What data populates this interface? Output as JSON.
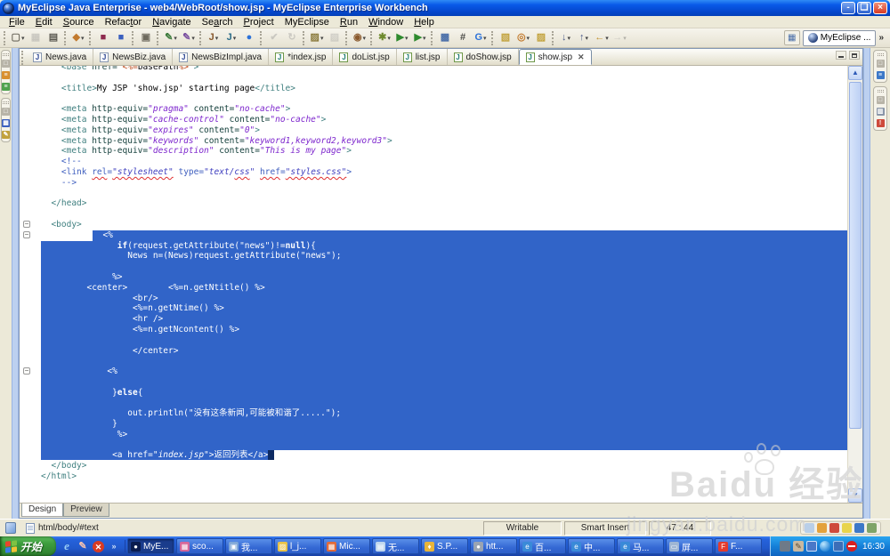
{
  "window": {
    "title": "MyEclipse Java Enterprise - web4/WebRoot/show.jsp - MyEclipse Enterprise Workbench",
    "controls": {
      "minimize": "-",
      "restore": "❏",
      "close": "×"
    }
  },
  "menubar": [
    {
      "label": "File",
      "u": 0
    },
    {
      "label": "Edit",
      "u": 0
    },
    {
      "label": "Source",
      "u": 0
    },
    {
      "label": "Refactor",
      "u": 5
    },
    {
      "label": "Navigate",
      "u": 0
    },
    {
      "label": "Search",
      "u": 2
    },
    {
      "label": "Project",
      "u": 0
    },
    {
      "label": "MyEclipse",
      "u": -1
    },
    {
      "label": "Run",
      "u": 0
    },
    {
      "label": "Window",
      "u": 0
    },
    {
      "label": "Help",
      "u": 0
    }
  ],
  "toolbar": {
    "groups": [
      [
        {
          "n": "new-button",
          "g": "▢",
          "c": "#6E6A5E",
          "dd": 1
        },
        {
          "n": "save-button",
          "g": "▦",
          "c": "#8A877E",
          "dis": 1
        },
        {
          "n": "print-button",
          "g": "▤",
          "c": "#5A5850"
        }
      ],
      [
        {
          "n": "new-web-component-button",
          "g": "◆",
          "c": "#C27A2E",
          "dd": 1
        }
      ],
      [
        {
          "n": "deploy-module-button",
          "g": "■",
          "c": "#8E2A4E"
        },
        {
          "n": "project-deploy-button",
          "g": "■",
          "c": "#3A5FBF"
        }
      ],
      [
        {
          "n": "database-explorer-button",
          "g": "▣",
          "c": "#6E6A5E"
        }
      ],
      [
        {
          "n": "new-class-button",
          "g": "✎",
          "c": "#3C7A3C",
          "dd": 1
        },
        {
          "n": "new-package-button",
          "g": "✎",
          "c": "#7A4FA0",
          "dd": 1
        }
      ],
      [
        {
          "n": "jar-button",
          "g": "J",
          "c": "#8A5A2E",
          "dd": 1
        },
        {
          "n": "jsp-deploy-button",
          "g": "J",
          "c": "#2E6E8A",
          "dd": 1
        },
        {
          "n": "web-browser-button",
          "g": "●",
          "c": "#2C72D9"
        }
      ],
      [
        {
          "n": "validate-button",
          "g": "✔",
          "c": "#8A877E",
          "dis": 1
        },
        {
          "n": "refresh-button",
          "g": "↻",
          "c": "#8A877E",
          "dis": 1
        }
      ],
      [
        {
          "n": "image-capture-button",
          "g": "▨",
          "c": "#8A7A3C",
          "dd": 1
        },
        {
          "n": "mail-button",
          "g": "▨",
          "c": "#9A968C",
          "dis": 1
        }
      ],
      [
        {
          "n": "snapshot-button",
          "g": "◉",
          "c": "#8A5A2E",
          "dd": 1
        }
      ],
      [
        {
          "n": "debug-button",
          "g": "✱",
          "c": "#6E8A2E",
          "dd": 1
        },
        {
          "n": "run-button",
          "g": "▶",
          "c": "#2E8A2E",
          "dd": 1
        },
        {
          "n": "external-tools-button",
          "g": "▶",
          "c": "#2E8A2E",
          "dd": 1
        }
      ],
      [
        {
          "n": "new-ear-button",
          "g": "▩",
          "c": "#4A6EA8"
        },
        {
          "n": "grid-button",
          "g": "#",
          "c": "#4A4A46"
        },
        {
          "n": "browser-g-button",
          "g": "G",
          "c": "#2C72D9",
          "dd": 1
        }
      ],
      [
        {
          "n": "import-button",
          "g": "▧",
          "c": "#C2A23C"
        },
        {
          "n": "search-button",
          "g": "◎",
          "c": "#C27A2E",
          "dd": 1
        },
        {
          "n": "open-folder-button",
          "g": "▨",
          "c": "#C2A23C"
        }
      ],
      [
        {
          "n": "last-edit-location-button",
          "g": "↓",
          "c": "#4A5A8A",
          "dd": 1
        },
        {
          "n": "next-annotation-button",
          "g": "↑",
          "c": "#4A5A8A",
          "dd": 1
        },
        {
          "n": "back-button",
          "g": "←",
          "c": "#C2912E",
          "dd": 1
        },
        {
          "n": "forward-button",
          "g": "→",
          "c": "#9A968C",
          "dis": 1,
          "dd": 1
        }
      ]
    ],
    "perspective": {
      "open_glyph": "▦",
      "label": "MyEclipse ...",
      "more": "»"
    }
  },
  "tabs": [
    {
      "label": "News.java",
      "type": "java"
    },
    {
      "label": "NewsBiz.java",
      "type": "java"
    },
    {
      "label": "NewsBizImpl.java",
      "type": "java"
    },
    {
      "label": "*index.jsp",
      "type": "jsp"
    },
    {
      "label": "doList.jsp",
      "type": "jsp"
    },
    {
      "label": "list.jsp",
      "type": "jsp"
    },
    {
      "label": "doShow.jsp",
      "type": "jsp"
    },
    {
      "label": "show.jsp",
      "type": "jsp",
      "active": true,
      "close": "✕"
    }
  ],
  "editor": {
    "lines": [
      {
        "seg": [
          [
            "t",
            "    <base"
          ],
          [
            "a",
            " href="
          ],
          [
            "v",
            "\""
          ],
          [
            "o",
            "<%="
          ],
          [
            "p",
            "basePath"
          ],
          [
            "o",
            "%>"
          ],
          [
            "v",
            "\""
          ],
          [
            "t",
            ">"
          ]
        ]
      },
      {
        "seg": []
      },
      {
        "seg": [
          [
            "t",
            "    <title>"
          ],
          [
            "p",
            "My JSP 'show.jsp' starting page"
          ],
          [
            "t",
            "</title>"
          ]
        ]
      },
      {
        "seg": []
      },
      {
        "seg": [
          [
            "t",
            "    <meta"
          ],
          [
            "a",
            " http-equiv="
          ],
          [
            "v",
            "\"pragma\""
          ],
          [
            "a",
            " content="
          ],
          [
            "v",
            "\"no-cache\""
          ],
          [
            "t",
            ">"
          ]
        ]
      },
      {
        "seg": [
          [
            "t",
            "    <meta"
          ],
          [
            "a",
            " http-equiv="
          ],
          [
            "v",
            "\"cache-control\""
          ],
          [
            "a",
            " content="
          ],
          [
            "v",
            "\"no-cache\""
          ],
          [
            "t",
            ">"
          ]
        ]
      },
      {
        "seg": [
          [
            "t",
            "    <meta"
          ],
          [
            "a",
            " http-equiv="
          ],
          [
            "v",
            "\"expires\""
          ],
          [
            "a",
            " content="
          ],
          [
            "v",
            "\"0\""
          ],
          [
            "t",
            ">"
          ]
        ]
      },
      {
        "seg": [
          [
            "t",
            "    <meta"
          ],
          [
            "a",
            " http-equiv="
          ],
          [
            "v",
            "\"keywords\""
          ],
          [
            "a",
            " content="
          ],
          [
            "v",
            "\"keyword1,keyword2,keyword3\""
          ],
          [
            "t",
            ">"
          ]
        ]
      },
      {
        "seg": [
          [
            "t",
            "    <meta"
          ],
          [
            "a",
            " http-equiv="
          ],
          [
            "v",
            "\"description\""
          ],
          [
            "a",
            " content="
          ],
          [
            "v",
            "\"This is my page\""
          ],
          [
            "t",
            ">"
          ]
        ]
      },
      {
        "seg": [
          [
            "c",
            "    <!--"
          ]
        ]
      },
      {
        "seg": [
          [
            "c",
            "    <link "
          ],
          [
            "cw",
            "rel"
          ],
          [
            "c",
            "="
          ],
          [
            "cvw",
            "\"stylesheet\""
          ],
          [
            "c",
            " type="
          ],
          [
            "cv",
            "\"text/"
          ],
          [
            "cvw",
            "css"
          ],
          [
            "cv",
            "\""
          ],
          [
            "c",
            " "
          ],
          [
            "cw",
            "href"
          ],
          [
            "c",
            "="
          ],
          [
            "cvw",
            "\"styles.css\""
          ],
          [
            "c",
            ">"
          ]
        ]
      },
      {
        "seg": [
          [
            "c",
            "    -->"
          ]
        ]
      },
      {
        "seg": []
      },
      {
        "seg": [
          [
            "t",
            "  </head>"
          ]
        ]
      },
      {
        "seg": []
      },
      {
        "fold": 1,
        "seg": [
          [
            "t",
            "  <body>"
          ]
        ]
      },
      {
        "fold": 1,
        "sel": "start",
        "off": 58,
        "seg": [
          [
            "w",
            "  <%"
          ]
        ]
      },
      {
        "sel": "full",
        "seg": [
          [
            "w",
            "               "
          ],
          [
            "wb",
            "if"
          ],
          [
            "w",
            "(request.getAttribute(\"news\")!="
          ],
          [
            "wb",
            "null"
          ],
          [
            "w",
            "){"
          ]
        ]
      },
      {
        "sel": "full",
        "seg": [
          [
            "w",
            "                 News n=(News)request.getAttribute(\"news\");"
          ]
        ]
      },
      {
        "sel": "full",
        "seg": []
      },
      {
        "sel": "full",
        "seg": [
          [
            "w",
            "              %>"
          ]
        ]
      },
      {
        "sel": "full",
        "seg": [
          [
            "w",
            "         <center>        <%=n.getNtitle() %>"
          ]
        ]
      },
      {
        "sel": "full",
        "seg": [
          [
            "w",
            "                  <br/>"
          ]
        ]
      },
      {
        "sel": "full",
        "seg": [
          [
            "w",
            "                  <%=n.getNtime() %>"
          ]
        ]
      },
      {
        "sel": "full",
        "seg": [
          [
            "w",
            "                  <hr />"
          ]
        ]
      },
      {
        "sel": "full",
        "seg": [
          [
            "w",
            "                  <%=n.getNcontent() %>"
          ]
        ]
      },
      {
        "sel": "full",
        "seg": []
      },
      {
        "sel": "full",
        "seg": [
          [
            "w",
            "                  </center>"
          ]
        ]
      },
      {
        "sel": "full",
        "seg": []
      },
      {
        "fold": 1,
        "sel": "full",
        "seg": [
          [
            "w",
            "             <%"
          ]
        ]
      },
      {
        "sel": "full",
        "seg": []
      },
      {
        "sel": "full",
        "seg": [
          [
            "w",
            "              }"
          ],
          [
            "wb",
            "else"
          ],
          [
            "w",
            "{"
          ]
        ]
      },
      {
        "sel": "full",
        "seg": []
      },
      {
        "sel": "full",
        "seg": [
          [
            "w",
            "                 out.println(\"没有这条新闻,可能被和谐了.....\");"
          ]
        ]
      },
      {
        "sel": "full",
        "seg": [
          [
            "w",
            "              }"
          ]
        ]
      },
      {
        "sel": "full",
        "seg": [
          [
            "w",
            "               %>"
          ]
        ]
      },
      {
        "sel": "full",
        "seg": []
      },
      {
        "sel": "end",
        "seg": [
          [
            "w",
            "              <a href="
          ],
          [
            "wi",
            "\"index.jsp\""
          ],
          [
            "w",
            ">返回列表</a>"
          ]
        ]
      },
      {
        "seg": [
          [
            "t",
            "  </body>"
          ]
        ]
      },
      {
        "seg": [
          [
            "t",
            "</html>"
          ]
        ]
      }
    ]
  },
  "bottom_tabs": [
    {
      "label": "Design",
      "active": true
    },
    {
      "label": "Preview",
      "active": false
    }
  ],
  "statusbar": {
    "context": "html/body/#text",
    "writable": "Writable",
    "insert_mode": "Smart Insert",
    "position": "47 : 44",
    "tray_icons": [
      {
        "n": "sync-view-icon",
        "c": "#B9CFE8"
      },
      {
        "n": "annotation-icon",
        "c": "#E3A23C"
      },
      {
        "n": "server-status-icon",
        "c": "#CE4A3B"
      },
      {
        "n": "warning-icon",
        "c": "#E8D44C"
      },
      {
        "n": "web-status-icon",
        "c": "#3C78C8"
      },
      {
        "n": "team-status-icon",
        "c": "#7FA468"
      }
    ]
  },
  "fastviews": {
    "left": [
      [
        {
          "n": "restore-pane-icon",
          "c": "#B8B4A8",
          "g": "□"
        },
        {
          "n": "package-explorer-icon",
          "c": "#D9902F",
          "g": "≡"
        },
        {
          "n": "hierarchy-icon",
          "c": "#4FA34F",
          "g": "≡"
        }
      ],
      [
        {
          "n": "restore-pane-icon",
          "c": "#B8B4A8",
          "g": "□"
        },
        {
          "n": "image-view-icon",
          "c": "#3A5FBF",
          "g": "▦"
        },
        {
          "n": "snippets-icon",
          "c": "#C2A23C",
          "g": "✎"
        }
      ]
    ],
    "right": [
      [
        {
          "n": "restore-pane-icon",
          "c": "#B8B4A8",
          "g": "□"
        },
        {
          "n": "outline-icon",
          "c": "#3C78C8",
          "g": "≡"
        }
      ],
      [
        {
          "n": "restore-pane-icon",
          "c": "#B8B4A8",
          "g": "□"
        },
        {
          "n": "console-icon",
          "c": "#8A96A8",
          "g": "▥"
        },
        {
          "n": "problems-icon",
          "c": "#CE4A3B",
          "g": "!"
        }
      ]
    ]
  },
  "watermark": {
    "main": "Baidu 经验",
    "sub": "jingyan.baidu.com"
  },
  "taskbar": {
    "start_label": "开始",
    "quick_launch": [
      {
        "n": "ie-icon",
        "g": "e",
        "cls": "q-ie"
      },
      {
        "n": "painter-icon",
        "g": "✎",
        "cls": "q-paint"
      },
      {
        "n": "close-app-icon",
        "g": "✕",
        "cls": "q-stop"
      },
      {
        "n": "more-chevron-icon",
        "g": "»",
        "cls": "q-more"
      }
    ],
    "tasks": [
      {
        "label": "MyE...",
        "active": true,
        "ic": "#0A1C4E",
        "g": "●"
      },
      {
        "label": "sco...",
        "ic": "#D5679A",
        "g": "▦"
      },
      {
        "label": "我...",
        "ic": "#7FA7D8",
        "g": "▣"
      },
      {
        "label": "l_j...",
        "ic": "#E8C24A",
        "g": "▨"
      },
      {
        "label": "Mic...",
        "ic": "#E06A3A",
        "g": "▦"
      },
      {
        "label": "无...",
        "ic": "#BFD6EE",
        "g": "▤"
      },
      {
        "label": "S.P...",
        "ic": "#E8B43A",
        "g": "♦"
      },
      {
        "label": "htt...",
        "ic": "#9AA4B2",
        "g": "●"
      },
      {
        "label": "百...",
        "ic": "#3A8AD8",
        "g": "e"
      },
      {
        "label": "中...",
        "ic": "#3A8AD8",
        "g": "e"
      },
      {
        "label": "马...",
        "ic": "#3A8AD8",
        "g": "e"
      },
      {
        "label": "屏...",
        "ic": "#9FB6D4",
        "g": "▭"
      },
      {
        "label": "F...",
        "ic": "#E23B2E",
        "g": "F"
      }
    ],
    "tray": {
      "icons": [
        {
          "n": "printer-icon",
          "cls": "ti-printer"
        },
        {
          "n": "pen-icon",
          "cls": "ti-pen",
          "g": "✎"
        },
        {
          "n": "display-icon",
          "cls": "ti-display"
        },
        {
          "n": "messenger-icon",
          "cls": "ti-msn"
        },
        {
          "n": "network-icon",
          "cls": "ti-net"
        },
        {
          "n": "blocked-icon",
          "cls": "ti-block"
        }
      ],
      "time": "16:30"
    }
  }
}
